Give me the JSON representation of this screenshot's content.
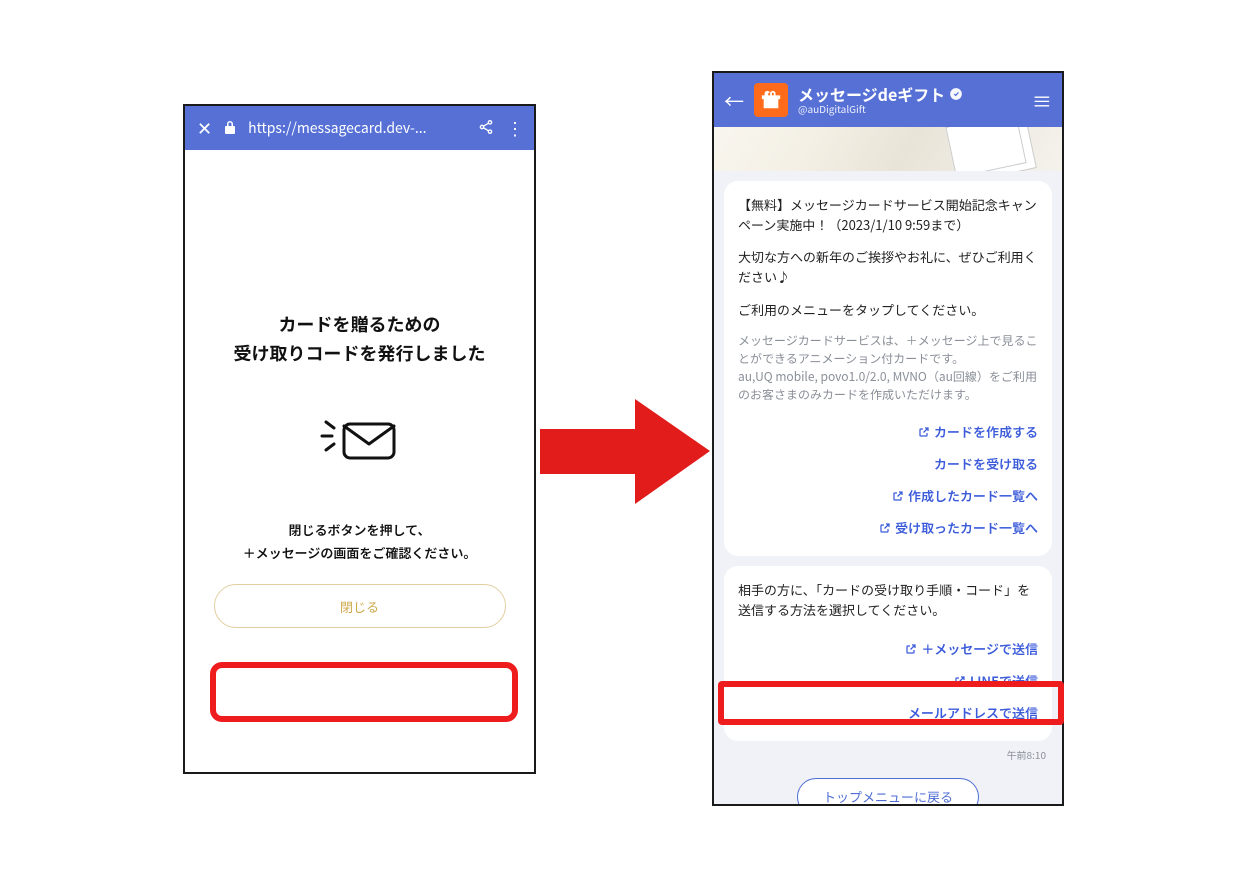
{
  "left": {
    "topbar": {
      "url": "https://messagecard.dev-..."
    },
    "heading_line1": "カードを贈るための",
    "heading_line2": "受け取りコードを発行しました",
    "subtext_line1": "閉じるボタンを押して、",
    "subtext_line2": "＋メッセージの画面をご確認ください。",
    "close_label": "閉じる"
  },
  "right": {
    "app_title": "メッセージdeギフト",
    "app_handle": "@auDigitalGift",
    "bubble1": {
      "p1": "【無料】メッセージカードサービス開始記念キャンペーン実施中！（2023/1/10 9:59まで）",
      "p2": "大切な方への新年のご挨拶やお礼に、ぜひご利用ください♪",
      "p3": "ご利用のメニューをタップしてください。",
      "gray": "メッセージカードサービスは、＋メッセージ上で見ることができるアニメーション付カードです。\nau,UQ mobile, povo1.0/2.0, MVNO（au回線）をご利用のお客さまのみカードを作成いただけます。",
      "links": {
        "create": "カードを作成する",
        "receive": "カードを受け取る",
        "created_list": "作成したカード一覧へ",
        "received_list": "受け取ったカード一覧へ"
      }
    },
    "bubble2": {
      "p1": "相手の方に、「カードの受け取り手順・コード」を送信する方法を選択してください。",
      "links": {
        "send_plusmsg": "＋メッセージで送信",
        "send_line": "LINEで送信",
        "send_mail": "メールアドレスで送信"
      }
    },
    "timestamp": "午前8:10",
    "back_to_top": "トップメニューに戻る"
  }
}
